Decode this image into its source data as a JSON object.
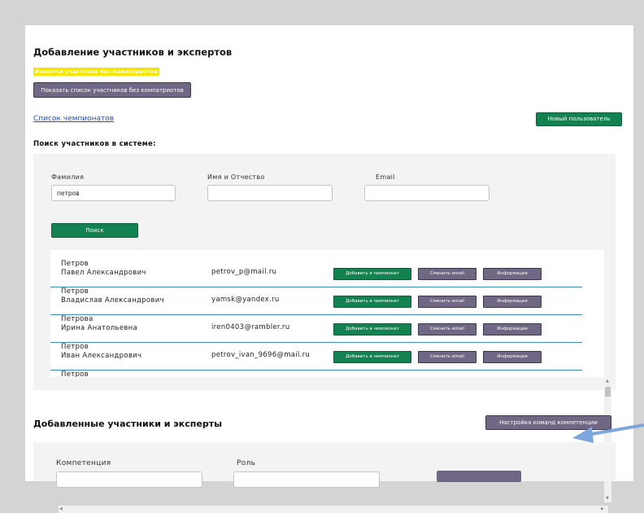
{
  "header": {
    "title": "Добавление участников и экспертов",
    "warning": "Имеются участники без компатриотов",
    "show_list_button": "Показать список участников без компатриотов"
  },
  "championship_link": "Список чемпионатов",
  "new_user_button": "Новый пользователь",
  "search": {
    "title": "Поиск участников в системе:",
    "fields": {
      "last_name": {
        "label": "Фамилия",
        "value": "петров"
      },
      "first_middle": {
        "label": "Имя и Отчество",
        "value": ""
      },
      "email": {
        "label": "Email",
        "value": ""
      }
    },
    "button": "Поиск"
  },
  "results": [
    {
      "last": "Петров",
      "first": "Павел Александрович",
      "email": "petrov_p@mail.ru"
    },
    {
      "last": "Петров",
      "first": "Владислав Александрович",
      "email": "yamsk@yandex.ru"
    },
    {
      "last": "Петрова",
      "first": "Ирина Анатольевна",
      "email": "iren0403@rambler.ru"
    },
    {
      "last": "Петров",
      "first": "Иван Александрович",
      "email": "petrov_ivan_9696@mail.ru"
    },
    {
      "last": "Петров",
      "first": "",
      "email": ""
    }
  ],
  "row_buttons": {
    "add": "Добавить в чемпионат",
    "change_email": "Сменить email",
    "info": "Информация"
  },
  "added": {
    "title": "Добавленные участники и эксперты",
    "team_settings_button": "Настройка команд компетенции",
    "filter_competence_label": "Компетенция",
    "filter_role_label": "Роль"
  },
  "colors": {
    "accent_green": "#138150",
    "accent_purple": "#6f6783",
    "warning_yellow": "#f5e600",
    "link_blue": "#1f4fbf",
    "pointer_arrow": "#7ea6dc"
  }
}
